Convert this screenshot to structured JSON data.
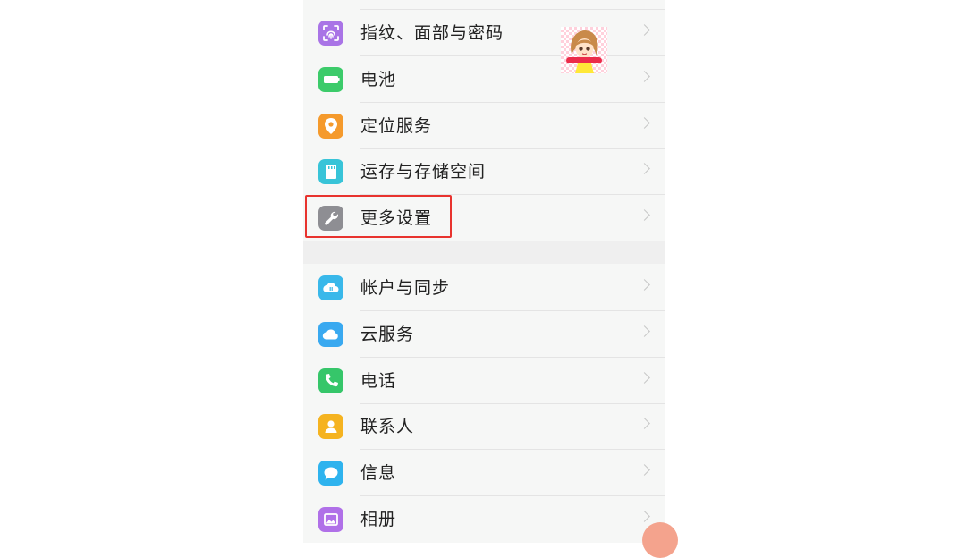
{
  "colors": {
    "accent_highlight": "#e8332e",
    "list_background": "#f6f7f6",
    "group_separator": "#efefef"
  },
  "settings": {
    "group1": [
      {
        "label": "指纹、面部与密码",
        "icon": "fingerprint-face-icon",
        "color": "#a974e6"
      },
      {
        "label": "电池",
        "icon": "battery-icon",
        "color": "#3ccb6a"
      },
      {
        "label": "定位服务",
        "icon": "location-pin-icon",
        "color": "#f59a2c"
      },
      {
        "label": "运存与存储空间",
        "icon": "storage-card-icon",
        "color": "#38c4d8"
      },
      {
        "label": "更多设置",
        "icon": "wrench-icon",
        "color": "#8e8e93"
      }
    ],
    "group2": [
      {
        "label": "帐户与同步",
        "icon": "account-sync-icon",
        "color": "#39b8ea"
      },
      {
        "label": "云服务",
        "icon": "cloud-icon",
        "color": "#39a9f0"
      },
      {
        "label": "电话",
        "icon": "phone-icon",
        "color": "#36c66a"
      },
      {
        "label": "联系人",
        "icon": "contact-icon",
        "color": "#f5b320"
      },
      {
        "label": "信息",
        "icon": "message-icon",
        "color": "#2eb3ee"
      },
      {
        "label": "相册",
        "icon": "gallery-icon",
        "color": "#b070e8"
      }
    ]
  }
}
